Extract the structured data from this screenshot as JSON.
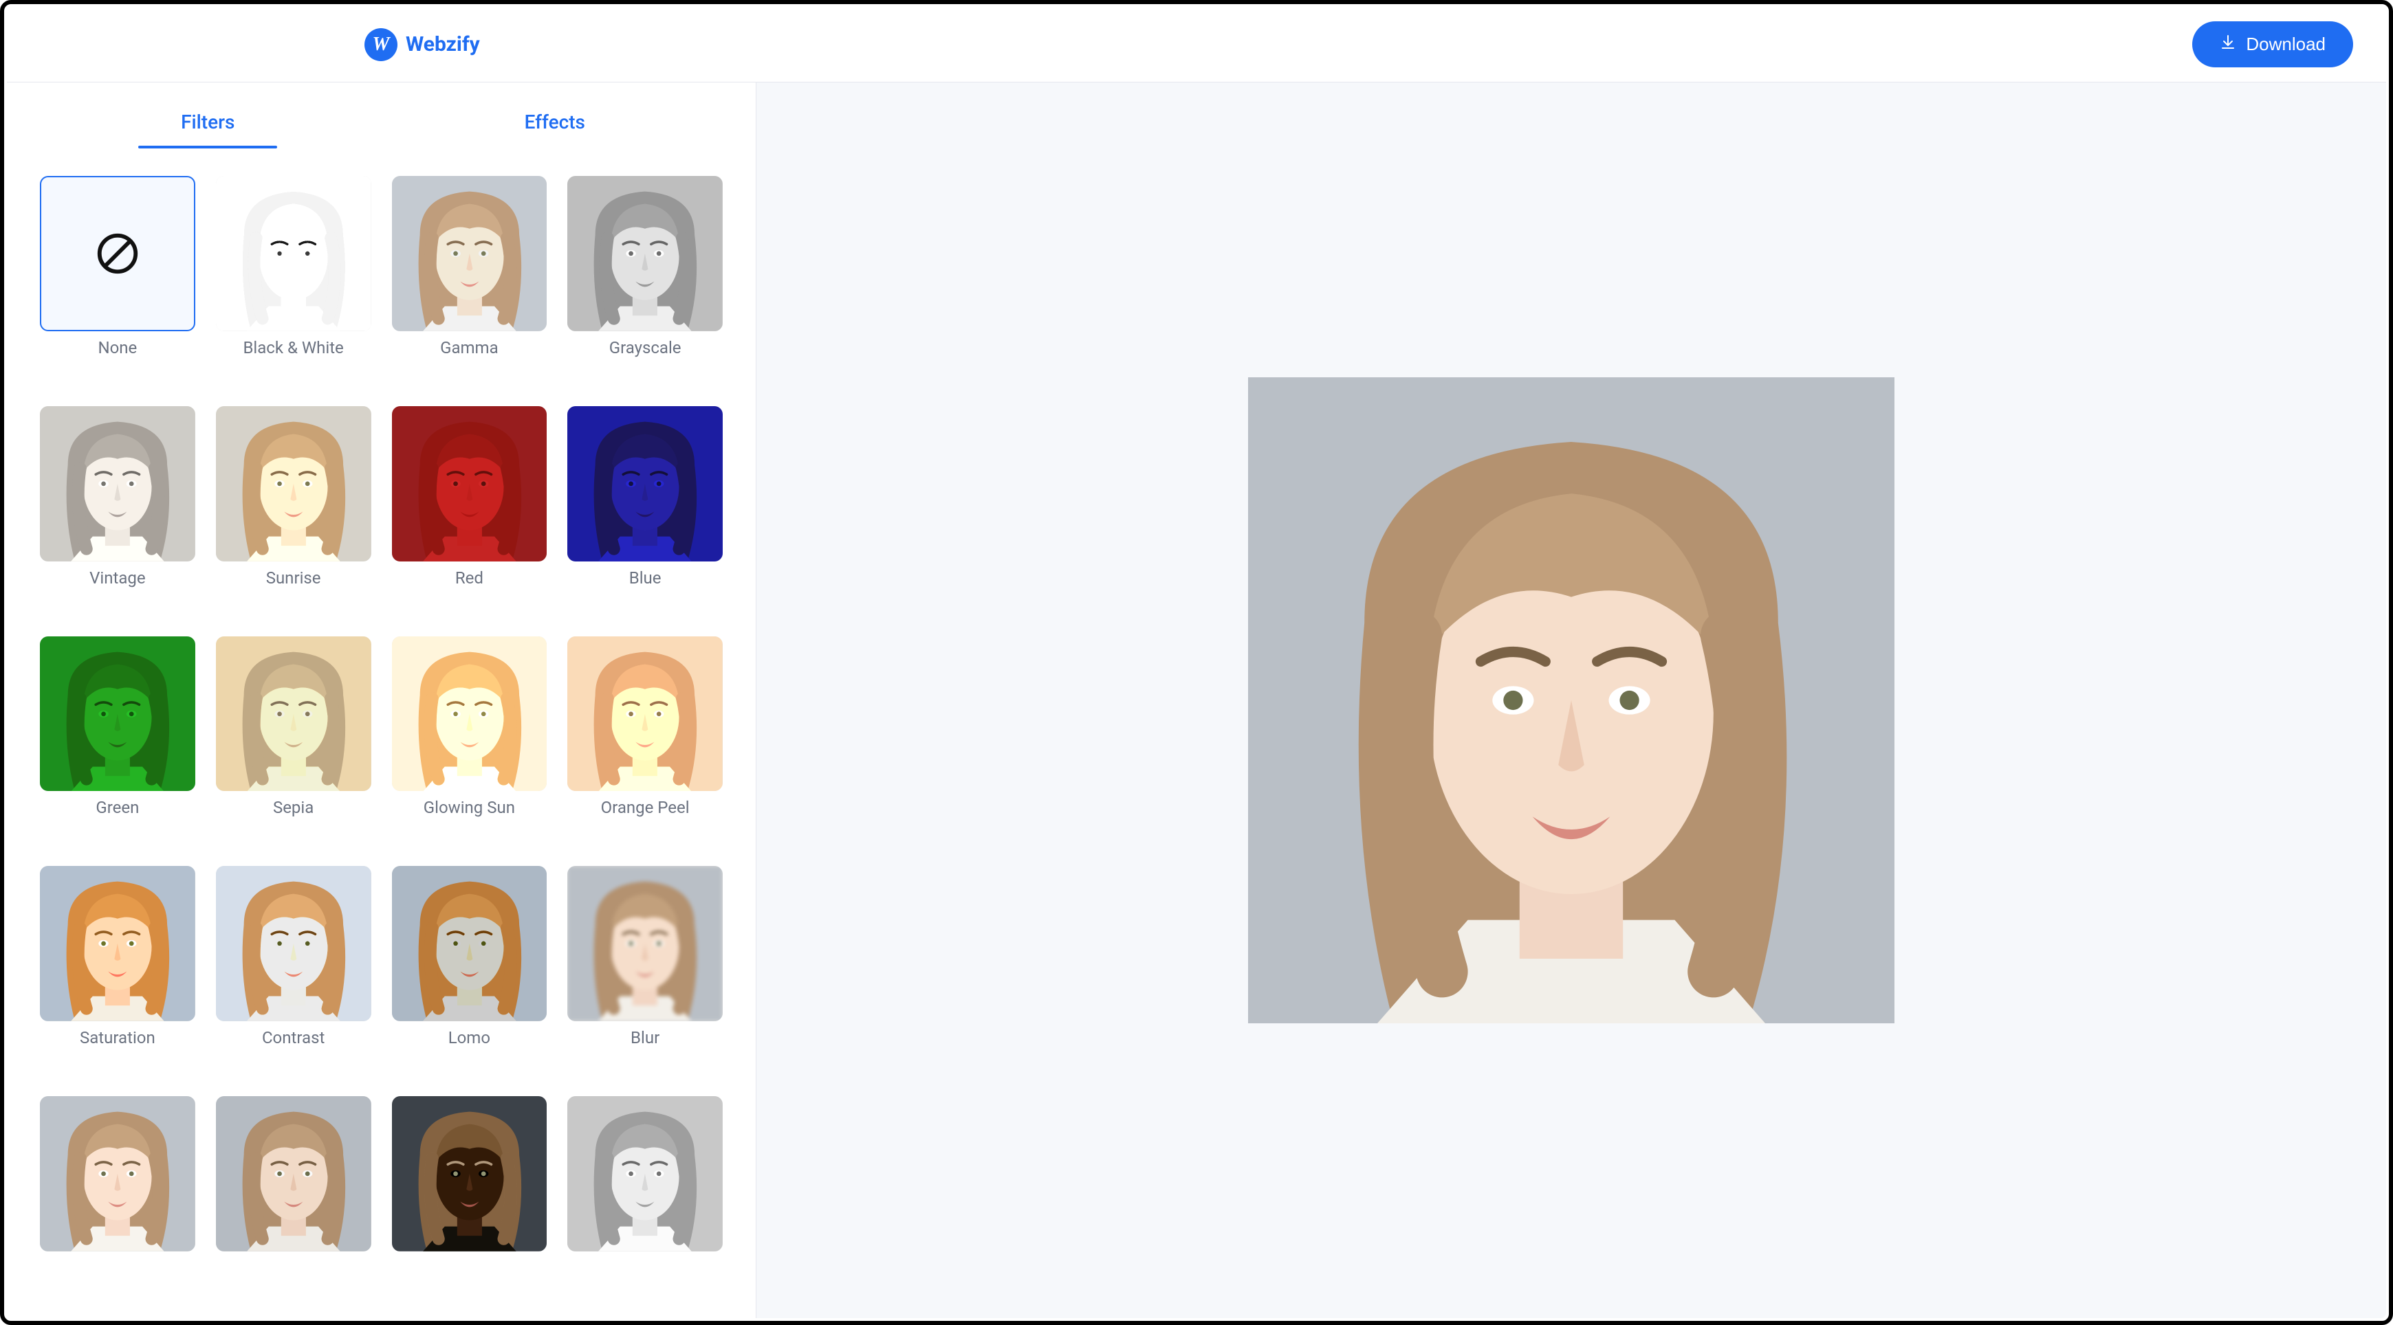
{
  "brand": {
    "name": "Webzify",
    "logo_letter": "W"
  },
  "header": {
    "download_label": "Download"
  },
  "tabs": {
    "filters": {
      "label": "Filters",
      "active": true
    },
    "effects": {
      "label": "Effects",
      "active": false
    }
  },
  "filters": [
    {
      "key": "none",
      "label": "None",
      "selected": true
    },
    {
      "key": "bw",
      "label": "Black & White",
      "selected": false
    },
    {
      "key": "gamma",
      "label": "Gamma",
      "selected": false
    },
    {
      "key": "grayscale",
      "label": "Grayscale",
      "selected": false
    },
    {
      "key": "vintage",
      "label": "Vintage",
      "selected": false
    },
    {
      "key": "sunrise",
      "label": "Sunrise",
      "selected": false
    },
    {
      "key": "red",
      "label": "Red",
      "selected": false
    },
    {
      "key": "blue",
      "label": "Blue",
      "selected": false
    },
    {
      "key": "green",
      "label": "Green",
      "selected": false
    },
    {
      "key": "sepia",
      "label": "Sepia",
      "selected": false
    },
    {
      "key": "glowingsun",
      "label": "Glowing Sun",
      "selected": false
    },
    {
      "key": "orangepeel",
      "label": "Orange Peel",
      "selected": false
    },
    {
      "key": "saturation",
      "label": "Saturation",
      "selected": false
    },
    {
      "key": "contrast",
      "label": "Contrast",
      "selected": false
    },
    {
      "key": "lomo",
      "label": "Lomo",
      "selected": false
    },
    {
      "key": "blur",
      "label": "Blur",
      "selected": false
    },
    {
      "key": "plain2",
      "label": "",
      "selected": false
    },
    {
      "key": "plain3",
      "label": "",
      "selected": false
    },
    {
      "key": "invert",
      "label": "",
      "selected": false
    },
    {
      "key": "plain-gray",
      "label": "",
      "selected": false
    }
  ],
  "colors": {
    "accent": "#1f6df2",
    "muted_text": "#6b7280",
    "canvas_bg": "#f6f8fb"
  }
}
